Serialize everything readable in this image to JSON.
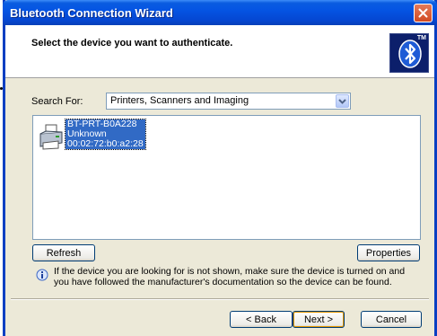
{
  "window": {
    "title": "Bluetooth Connection Wizard"
  },
  "header": {
    "title": "Select the device you want to authenticate.",
    "logo_mark": "TM"
  },
  "search": {
    "label": "Search For:",
    "selected": "Printers, Scanners and Imaging"
  },
  "devices": [
    {
      "name": "BT-PRT-B0A228",
      "type": "Unknown",
      "address": "00:02:72:b0:a2:28",
      "icon": "printer-icon",
      "selected": true
    }
  ],
  "buttons": {
    "refresh": "Refresh",
    "properties": "Properties",
    "back": "< Back",
    "next": "Next >",
    "cancel": "Cancel"
  },
  "info": {
    "text": "If the device you are looking for is not shown, make sure the device is turned on and you have followed the manufacturer's documentation so the device can be found."
  },
  "colors": {
    "titlebar": "#0554e3",
    "selection": "#316ac5",
    "face": "#ece9d8"
  }
}
